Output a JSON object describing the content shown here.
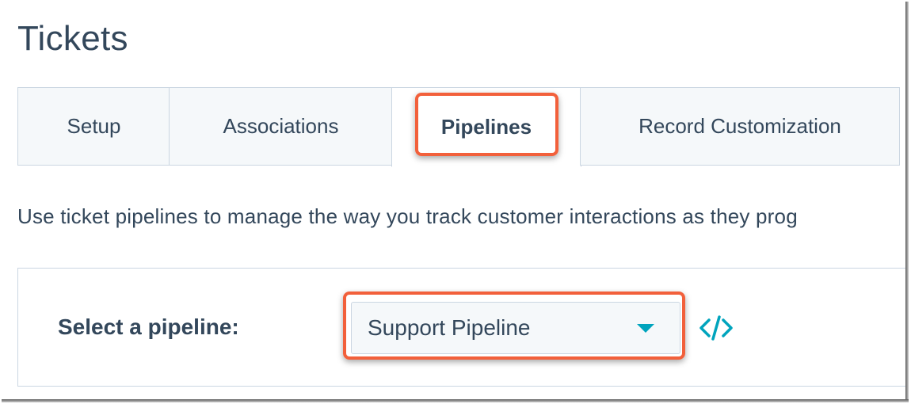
{
  "page": {
    "title": "Tickets"
  },
  "tabs": [
    {
      "label": "Setup",
      "active": false
    },
    {
      "label": "Associations",
      "active": false
    },
    {
      "label": "Pipelines",
      "active": true
    },
    {
      "label": "Record Customization",
      "active": false
    }
  ],
  "intro": {
    "text": "Use ticket pipelines to manage the way you track customer interactions as they prog"
  },
  "pipeline_selector": {
    "label": "Select a pipeline:",
    "selected_value": "Support Pipeline",
    "dropdown_icon": "caret-down-icon",
    "embed_icon": "code-icon"
  },
  "colors": {
    "highlight": "#f2603b",
    "accent": "#00a4bd",
    "text": "#33475b",
    "border": "#cbd6e2",
    "tab_bg": "#f5f8fa"
  }
}
